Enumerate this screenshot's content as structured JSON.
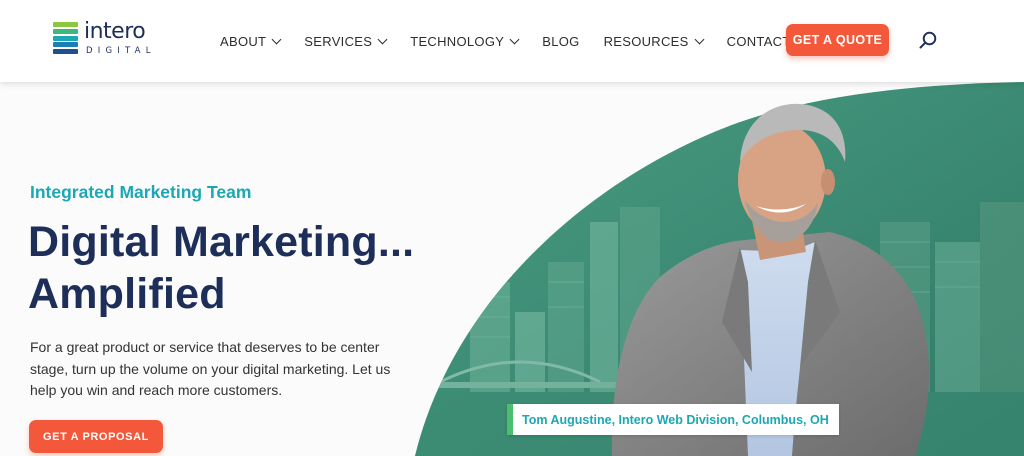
{
  "brand": {
    "name": "intero",
    "sub": "DIGITAL",
    "bar_colors": [
      "#8dc63f",
      "#3fb67a",
      "#1ba8b4",
      "#1b7fb6",
      "#1d4f91"
    ]
  },
  "nav": {
    "items": [
      {
        "label": "ABOUT",
        "dropdown": true
      },
      {
        "label": "SERVICES",
        "dropdown": true
      },
      {
        "label": "TECHNOLOGY",
        "dropdown": true
      },
      {
        "label": "BLOG",
        "dropdown": false
      },
      {
        "label": "RESOURCES",
        "dropdown": true
      },
      {
        "label": "CONTACT US",
        "dropdown": false
      }
    ],
    "cta_label": "GET A QUOTE",
    "search_icon": "search-icon"
  },
  "hero": {
    "eyebrow": "Integrated Marketing Team",
    "headline_line1": "Digital Marketing...",
    "headline_line2": "Amplified",
    "body": "For a great product or service that deserves to be center stage, turn up the volume on your digital marketing. Let us help you win and reach more customers.",
    "cta_label": "GET A PROPOSAL",
    "caption": "Tom Augustine, Intero Web Division, Columbus, OH"
  },
  "colors": {
    "accent": "#f4583b",
    "navy": "#1d2e59",
    "teal": "#1ba8b4",
    "green_panel": "#3f8f78",
    "caption_bar": "#4cbf6e"
  }
}
